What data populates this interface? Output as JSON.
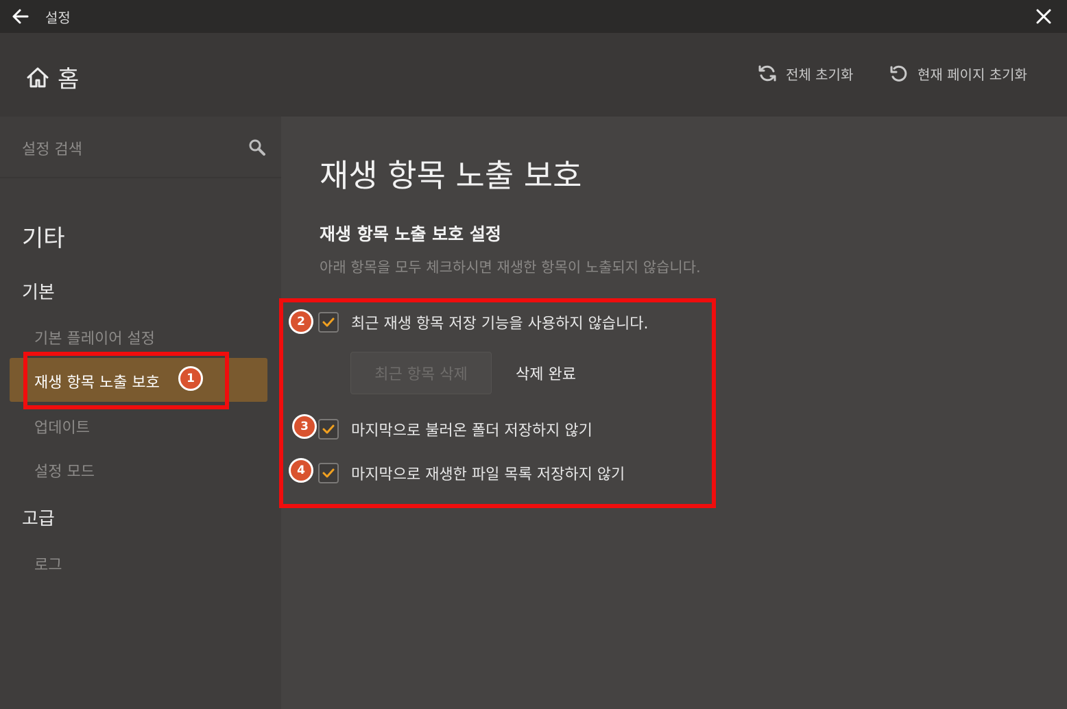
{
  "titlebar": {
    "title": "설정",
    "back_icon": "arrow-left-icon",
    "close_icon": "close-icon"
  },
  "header": {
    "home_label": "홈",
    "home_icon": "home-icon",
    "reset_all_label": "전체 초기화",
    "reset_page_label": "현재 페이지 초기화"
  },
  "sidebar": {
    "search_placeholder": "설정 검색",
    "section_title": "기타",
    "groups": [
      {
        "title": "기본",
        "items": [
          "기본 플레이어 설정",
          "재생 항목 노출 보호",
          "업데이트",
          "설정 모드"
        ]
      },
      {
        "title": "고급",
        "items": [
          "로그"
        ]
      }
    ],
    "active_item": "재생 항목 노출 보호"
  },
  "main": {
    "title": "재생 항목 노출 보호",
    "subtitle": "재생 항목 노출 보호 설정",
    "description": "아래 항목을 모두 체크하시면 재생한 항목이 노출되지 않습니다.",
    "options": [
      {
        "label": "최근 재생 항목 저장 기능을 사용하지 않습니다.",
        "checked": true
      },
      {
        "label": "마지막으로 불러온 폴더 저장하지 않기",
        "checked": true
      },
      {
        "label": "마지막으로 재생한 파일 목록 저장하지 않기",
        "checked": true
      }
    ],
    "delete_button_label": "최근 항목 삭제",
    "delete_status": "삭제 완료"
  },
  "annotations": {
    "badges": [
      "1",
      "2",
      "3",
      "4"
    ]
  },
  "colors": {
    "accent": "#7a5a2f",
    "check": "#f0a020",
    "highlight": "#f00d0d",
    "badge": "#d9532f"
  }
}
